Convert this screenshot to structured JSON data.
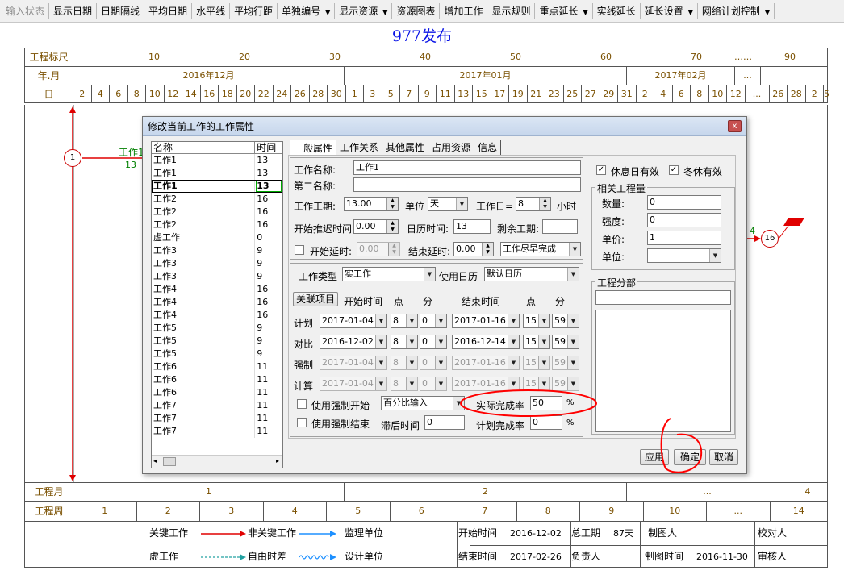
{
  "toolbar": [
    {
      "label": "输入状态",
      "disabled": true
    },
    {
      "label": "显示日期"
    },
    {
      "label": "日期隔线"
    },
    {
      "label": "平均日期"
    },
    {
      "label": "水平线"
    },
    {
      "label": "平均行距"
    },
    {
      "label": "单独编号",
      "dropdown": true
    },
    {
      "label": "显示资源",
      "dropdown": true
    },
    {
      "label": "资源图表"
    },
    {
      "label": "增加工作"
    },
    {
      "label": "显示规则"
    },
    {
      "label": "重点延长",
      "dropdown": true
    },
    {
      "label": "实线延长"
    },
    {
      "label": "延长设置",
      "dropdown": true
    },
    {
      "label": "网络计划控制",
      "dropdown": true
    }
  ],
  "chart_title": "977发布",
  "scale": {
    "label_ruler": "工程标尺",
    "ruler_ticks": [
      "10",
      "20",
      "30",
      "40",
      "50",
      "60",
      "70",
      "……",
      "90"
    ],
    "label_month": "年.月",
    "months": [
      "2016年12月",
      "2017年01月",
      "2017年02月",
      "..."
    ],
    "label_day": "日",
    "days": [
      "2",
      "4",
      "6",
      "8",
      "10",
      "12",
      "14",
      "16",
      "18",
      "20",
      "22",
      "24",
      "26",
      "28",
      "30",
      "1",
      "3",
      "5",
      "7",
      "9",
      "11",
      "13",
      "15",
      "17",
      "19",
      "21",
      "23",
      "25",
      "27",
      "29",
      "31",
      "2",
      "4",
      "6",
      "8",
      "10",
      "12",
      "...",
      "26",
      "28",
      "2",
      "5"
    ]
  },
  "gantt": {
    "start_node": "1",
    "task_label": "工作1",
    "task_duration": "13",
    "end_node": "16",
    "end_label": "4"
  },
  "bottom": {
    "label_month": "工程月",
    "months": [
      "1",
      "2",
      "...",
      "4"
    ],
    "label_week": "工程周",
    "weeks": [
      "1",
      "2",
      "3",
      "4",
      "5",
      "6",
      "7",
      "8",
      "9",
      "10",
      "...",
      "14"
    ]
  },
  "legend": {
    "critical": "关键工作",
    "noncritical": "非关键工作",
    "virtual": "虚工作",
    "float": "自由时差",
    "supervisor": "监理单位",
    "designer": "设计单位",
    "start_label": "开始时间",
    "start_value": "2016-12-02",
    "end_label": "结束时间",
    "end_value": "2017-02-26",
    "duration_label": "总工期",
    "duration_value": "87天",
    "owner_label": "负责人",
    "drawer_label": "制图人",
    "draw_time_label": "制图时间",
    "draw_time_value": "2016-11-30",
    "checker_label": "校对人",
    "reviewer_label": "审核人"
  },
  "dialog": {
    "title": "修改当前工作的工作属性",
    "close": "x",
    "list": {
      "col_name": "名称",
      "col_time": "时间",
      "rows": [
        {
          "name": "工作1",
          "time": "13"
        },
        {
          "name": "工作1",
          "time": "13"
        },
        {
          "name": "工作1",
          "time": "13",
          "selected": true
        },
        {
          "name": "工作2",
          "time": "16"
        },
        {
          "name": "工作2",
          "time": "16"
        },
        {
          "name": "工作2",
          "time": "16"
        },
        {
          "name": "虚工作",
          "time": "0"
        },
        {
          "name": "工作3",
          "time": "9"
        },
        {
          "name": "工作3",
          "time": "9"
        },
        {
          "name": "工作3",
          "time": "9"
        },
        {
          "name": "工作4",
          "time": "16"
        },
        {
          "name": "工作4",
          "time": "16"
        },
        {
          "name": "工作4",
          "time": "16"
        },
        {
          "name": "工作5",
          "time": "9"
        },
        {
          "name": "工作5",
          "time": "9"
        },
        {
          "name": "工作5",
          "time": "9"
        },
        {
          "name": "工作6",
          "time": "11"
        },
        {
          "name": "工作6",
          "time": "11"
        },
        {
          "name": "工作6",
          "time": "11"
        },
        {
          "name": "工作7",
          "time": "11"
        },
        {
          "name": "工作7",
          "time": "11"
        },
        {
          "name": "工作7",
          "time": "11"
        }
      ]
    },
    "tabs": [
      "一般属性",
      "工作关系",
      "其他属性",
      "占用资源",
      "信息"
    ],
    "general": {
      "name_label": "工作名称:",
      "name_value": "工作1",
      "name2_label": "第二名称:",
      "name2_value": "",
      "duration_label": "工作工期:",
      "duration_value": "13.00",
      "unit_label": "单位",
      "unit_value": "天",
      "workday_label": "工作日=",
      "workday_value": "8",
      "hour_label": "小时",
      "delay_label": "开始推迟时间",
      "delay_value": "0.00",
      "calendar_time_label": "日历时间:",
      "calendar_time_value": "13",
      "remaining_label": "剩余工期:",
      "remaining_value": "",
      "start_lag_label": "开始延时:",
      "start_lag_value": "0.00",
      "end_lag_label": "结束延时:",
      "end_lag_value": "0.00",
      "schedule_value": "工作尽早完成",
      "type_label": "工作类型",
      "type_value": "实工作",
      "use_calendar_label": "使用日历",
      "calendar_value": "默认日历"
    },
    "times": {
      "related_btn": "关联项目",
      "start_header": "开始时间",
      "hour_header": "点",
      "min_header": "分",
      "end_header": "结束时间",
      "rows": [
        {
          "label": "计划",
          "sdate": "2017-01-04",
          "sh": "8",
          "sm": "0",
          "edate": "2017-01-16",
          "eh": "15",
          "em": "59",
          "disabled": false
        },
        {
          "label": "对比",
          "sdate": "2016-12-02",
          "sh": "8",
          "sm": "0",
          "edate": "2016-12-14",
          "eh": "15",
          "em": "59",
          "disabled": false
        },
        {
          "label": "强制",
          "sdate": "2017-01-04",
          "sh": "8",
          "sm": "0",
          "edate": "2017-01-16",
          "eh": "15",
          "em": "59",
          "disabled": true
        },
        {
          "label": "计算",
          "sdate": "2017-01-04",
          "sh": "8",
          "sm": "0",
          "edate": "2017-01-16",
          "eh": "15",
          "em": "59",
          "disabled": true
        }
      ],
      "force_start_label": "使用强制开始",
      "force_end_label": "使用强制结束",
      "percent_mode": "百分比输入",
      "actual_label": "实际完成率",
      "actual_value": "50",
      "pct": "%",
      "lag_label": "滞后时间",
      "lag_value": "0",
      "plan_label": "计划完成率",
      "plan_value": "0"
    },
    "right": {
      "rest_valid": "休息日有效",
      "winter_valid": "冬休有效",
      "qty_group": "相关工程量",
      "qty_label": "数量:",
      "qty_value": "0",
      "intensity_label": "强度:",
      "intensity_value": "0",
      "price_label": "单价:",
      "price_value": "1",
      "unit_label": "单位:",
      "unit_value": "",
      "part_group": "工程分部",
      "part_value": ""
    },
    "buttons": {
      "apply": "应用",
      "ok": "确定",
      "cancel": "取消"
    }
  },
  "colors": {
    "title": "#0a14e6",
    "critical": "#e00000",
    "noncritical": "#1e90ff",
    "annotation": "#ff0000"
  }
}
